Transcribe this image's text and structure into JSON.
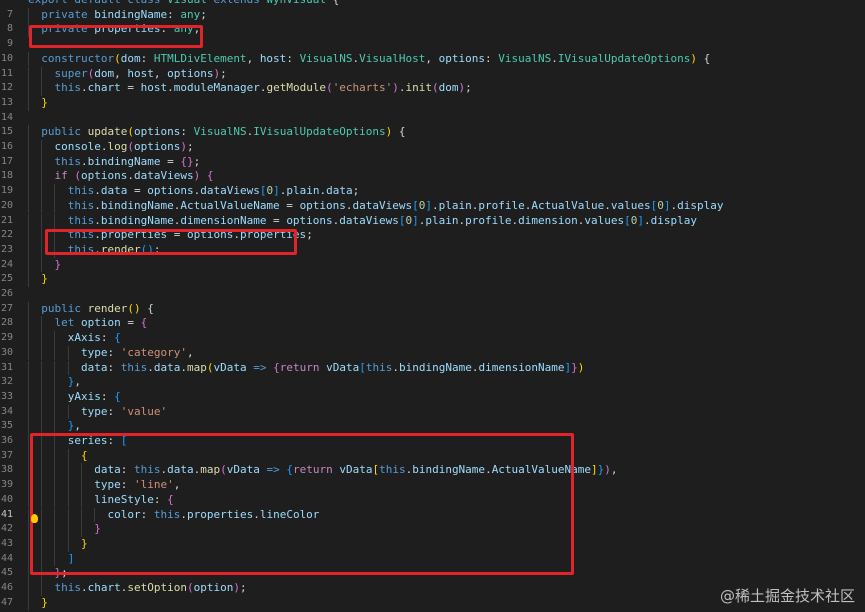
{
  "editor": {
    "lines": [
      {
        "n": "",
        "segs": [
          [
            "k",
            "export "
          ],
          [
            "k",
            "default "
          ],
          [
            "k",
            "class "
          ],
          [
            "t",
            "Visual "
          ],
          [
            "k",
            "extends "
          ],
          [
            "t",
            "WynVisual "
          ],
          [
            "p",
            "{"
          ]
        ]
      },
      {
        "n": "7",
        "segs": [
          [
            "k",
            "  private "
          ],
          [
            "v",
            "bindingName"
          ],
          [
            "p",
            ": "
          ],
          [
            "t",
            "any"
          ],
          [
            "p",
            ";"
          ]
        ]
      },
      {
        "n": "8",
        "segs": [
          [
            "k",
            "  private "
          ],
          [
            "v",
            "properties"
          ],
          [
            "p",
            ": "
          ],
          [
            "t",
            "any"
          ],
          [
            "p",
            ";"
          ]
        ]
      },
      {
        "n": "9",
        "segs": []
      },
      {
        "n": "10",
        "segs": [
          [
            "k",
            "  constructor"
          ],
          [
            "y",
            "("
          ],
          [
            "v",
            "dom"
          ],
          [
            "p",
            ": "
          ],
          [
            "t",
            "HTMLDivElement"
          ],
          [
            "p",
            ", "
          ],
          [
            "v",
            "host"
          ],
          [
            "p",
            ": "
          ],
          [
            "t",
            "VisualNS"
          ],
          [
            "p",
            "."
          ],
          [
            "t",
            "VisualHost"
          ],
          [
            "p",
            ", "
          ],
          [
            "v",
            "options"
          ],
          [
            "p",
            ": "
          ],
          [
            "t",
            "VisualNS"
          ],
          [
            "p",
            "."
          ],
          [
            "t",
            "IVisualUpdateOptions"
          ],
          [
            "y",
            ")"
          ],
          [
            "p",
            " {"
          ]
        ]
      },
      {
        "n": "11",
        "segs": [
          [
            "k",
            "    super"
          ],
          [
            "pk",
            "("
          ],
          [
            "v",
            "dom"
          ],
          [
            "p",
            ", "
          ],
          [
            "v",
            "host"
          ],
          [
            "p",
            ", "
          ],
          [
            "v",
            "options"
          ],
          [
            "pk",
            ")"
          ],
          [
            "p",
            ";"
          ]
        ]
      },
      {
        "n": "12",
        "segs": [
          [
            "k",
            "    this"
          ],
          [
            "p",
            "."
          ],
          [
            "v",
            "chart"
          ],
          [
            "p",
            " = "
          ],
          [
            "v",
            "host"
          ],
          [
            "p",
            "."
          ],
          [
            "v",
            "moduleManager"
          ],
          [
            "p",
            "."
          ],
          [
            "f",
            "getModule"
          ],
          [
            "pk",
            "("
          ],
          [
            "s",
            "'echarts'"
          ],
          [
            "pk",
            ")"
          ],
          [
            "p",
            "."
          ],
          [
            "f",
            "init"
          ],
          [
            "pk",
            "("
          ],
          [
            "v",
            "dom"
          ],
          [
            "pk",
            ")"
          ],
          [
            "p",
            ";"
          ]
        ]
      },
      {
        "n": "13",
        "segs": [
          [
            "y",
            "  }"
          ]
        ]
      },
      {
        "n": "14",
        "segs": []
      },
      {
        "n": "15",
        "segs": [
          [
            "k",
            "  public "
          ],
          [
            "f",
            "update"
          ],
          [
            "y",
            "("
          ],
          [
            "v",
            "options"
          ],
          [
            "p",
            ": "
          ],
          [
            "t",
            "VisualNS"
          ],
          [
            "p",
            "."
          ],
          [
            "t",
            "IVisualUpdateOptions"
          ],
          [
            "y",
            ")"
          ],
          [
            "p",
            " {"
          ]
        ]
      },
      {
        "n": "16",
        "segs": [
          [
            "v",
            "    console"
          ],
          [
            "p",
            "."
          ],
          [
            "f",
            "log"
          ],
          [
            "pk",
            "("
          ],
          [
            "v",
            "options"
          ],
          [
            "pk",
            ")"
          ],
          [
            "p",
            ";"
          ]
        ]
      },
      {
        "n": "17",
        "segs": [
          [
            "k",
            "    this"
          ],
          [
            "p",
            "."
          ],
          [
            "v",
            "bindingName"
          ],
          [
            "p",
            " = "
          ],
          [
            "pk",
            "{}"
          ],
          [
            "p",
            ";"
          ]
        ]
      },
      {
        "n": "18",
        "segs": [
          [
            "c",
            "    if "
          ],
          [
            "pk",
            "("
          ],
          [
            "v",
            "options"
          ],
          [
            "p",
            "."
          ],
          [
            "v",
            "dataViews"
          ],
          [
            "pk",
            ")"
          ],
          [
            "p",
            " "
          ],
          [
            "pk",
            "{"
          ]
        ]
      },
      {
        "n": "19",
        "segs": [
          [
            "k",
            "      this"
          ],
          [
            "p",
            "."
          ],
          [
            "v",
            "data"
          ],
          [
            "p",
            " = "
          ],
          [
            "v",
            "options"
          ],
          [
            "p",
            "."
          ],
          [
            "v",
            "dataViews"
          ],
          [
            "bl",
            "["
          ],
          [
            "n",
            "0"
          ],
          [
            "bl",
            "]"
          ],
          [
            "p",
            "."
          ],
          [
            "v",
            "plain"
          ],
          [
            "p",
            "."
          ],
          [
            "v",
            "data"
          ],
          [
            "p",
            ";"
          ]
        ]
      },
      {
        "n": "20",
        "segs": [
          [
            "k",
            "      this"
          ],
          [
            "p",
            "."
          ],
          [
            "v",
            "bindingName"
          ],
          [
            "p",
            "."
          ],
          [
            "v",
            "ActualValueName"
          ],
          [
            "p",
            " = "
          ],
          [
            "v",
            "options"
          ],
          [
            "p",
            "."
          ],
          [
            "v",
            "dataViews"
          ],
          [
            "bl",
            "["
          ],
          [
            "n",
            "0"
          ],
          [
            "bl",
            "]"
          ],
          [
            "p",
            "."
          ],
          [
            "v",
            "plain"
          ],
          [
            "p",
            "."
          ],
          [
            "v",
            "profile"
          ],
          [
            "p",
            "."
          ],
          [
            "v",
            "ActualValue"
          ],
          [
            "p",
            "."
          ],
          [
            "v",
            "values"
          ],
          [
            "bl",
            "["
          ],
          [
            "n",
            "0"
          ],
          [
            "bl",
            "]"
          ],
          [
            "p",
            "."
          ],
          [
            "v",
            "display"
          ]
        ]
      },
      {
        "n": "21",
        "segs": [
          [
            "k",
            "      this"
          ],
          [
            "p",
            "."
          ],
          [
            "v",
            "bindingName"
          ],
          [
            "p",
            "."
          ],
          [
            "v",
            "dimensionName"
          ],
          [
            "p",
            " = "
          ],
          [
            "v",
            "options"
          ],
          [
            "p",
            "."
          ],
          [
            "v",
            "dataViews"
          ],
          [
            "bl",
            "["
          ],
          [
            "n",
            "0"
          ],
          [
            "bl",
            "]"
          ],
          [
            "p",
            "."
          ],
          [
            "v",
            "plain"
          ],
          [
            "p",
            "."
          ],
          [
            "v",
            "profile"
          ],
          [
            "p",
            "."
          ],
          [
            "v",
            "dimension"
          ],
          [
            "p",
            "."
          ],
          [
            "v",
            "values"
          ],
          [
            "bl",
            "["
          ],
          [
            "n",
            "0"
          ],
          [
            "bl",
            "]"
          ],
          [
            "p",
            "."
          ],
          [
            "v",
            "display"
          ]
        ]
      },
      {
        "n": "22",
        "segs": [
          [
            "k",
            "      this"
          ],
          [
            "p",
            "."
          ],
          [
            "v",
            "properties"
          ],
          [
            "p",
            " = "
          ],
          [
            "v",
            "options"
          ],
          [
            "p",
            "."
          ],
          [
            "v",
            "properties"
          ],
          [
            "p",
            ";"
          ]
        ]
      },
      {
        "n": "23",
        "segs": [
          [
            "k",
            "      this"
          ],
          [
            "p",
            "."
          ],
          [
            "f",
            "render"
          ],
          [
            "bl",
            "()"
          ],
          [
            "p",
            ";"
          ]
        ]
      },
      {
        "n": "24",
        "segs": [
          [
            "pk",
            "    }"
          ]
        ]
      },
      {
        "n": "25",
        "segs": [
          [
            "y",
            "  }"
          ]
        ]
      },
      {
        "n": "26",
        "segs": []
      },
      {
        "n": "27",
        "segs": [
          [
            "k",
            "  public "
          ],
          [
            "f",
            "render"
          ],
          [
            "y",
            "()"
          ],
          [
            "p",
            " {"
          ]
        ]
      },
      {
        "n": "28",
        "segs": [
          [
            "k",
            "    let "
          ],
          [
            "v",
            "option"
          ],
          [
            "p",
            " = "
          ],
          [
            "pk",
            "{"
          ]
        ]
      },
      {
        "n": "29",
        "segs": [
          [
            "v",
            "      xAxis"
          ],
          [
            "p",
            ": "
          ],
          [
            "bl",
            "{"
          ]
        ]
      },
      {
        "n": "30",
        "segs": [
          [
            "v",
            "        type"
          ],
          [
            "p",
            ": "
          ],
          [
            "s",
            "'category'"
          ],
          [
            "p",
            ","
          ]
        ]
      },
      {
        "n": "31",
        "segs": [
          [
            "v",
            "        data"
          ],
          [
            "p",
            ": "
          ],
          [
            "k",
            "this"
          ],
          [
            "p",
            "."
          ],
          [
            "v",
            "data"
          ],
          [
            "p",
            "."
          ],
          [
            "f",
            "map"
          ],
          [
            "y",
            "("
          ],
          [
            "v",
            "vData"
          ],
          [
            "k",
            " => "
          ],
          [
            "pk",
            "{"
          ],
          [
            "c",
            "return "
          ],
          [
            "v",
            "vData"
          ],
          [
            "bl",
            "["
          ],
          [
            "k",
            "this"
          ],
          [
            "p",
            "."
          ],
          [
            "v",
            "bindingName"
          ],
          [
            "p",
            "."
          ],
          [
            "v",
            "dimensionName"
          ],
          [
            "bl",
            "]"
          ],
          [
            "pk",
            "}"
          ],
          [
            "y",
            ")"
          ]
        ]
      },
      {
        "n": "32",
        "segs": [
          [
            "bl",
            "      }"
          ],
          [
            "p",
            ","
          ]
        ]
      },
      {
        "n": "33",
        "segs": [
          [
            "v",
            "      yAxis"
          ],
          [
            "p",
            ": "
          ],
          [
            "bl",
            "{"
          ]
        ]
      },
      {
        "n": "34",
        "segs": [
          [
            "v",
            "        type"
          ],
          [
            "p",
            ": "
          ],
          [
            "s",
            "'value'"
          ]
        ]
      },
      {
        "n": "35",
        "segs": [
          [
            "bl",
            "      }"
          ],
          [
            "p",
            ","
          ]
        ]
      },
      {
        "n": "36",
        "segs": [
          [
            "v",
            "      series"
          ],
          [
            "p",
            ": "
          ],
          [
            "bl",
            "["
          ]
        ]
      },
      {
        "n": "37",
        "segs": [
          [
            "y",
            "        {"
          ]
        ]
      },
      {
        "n": "38",
        "segs": [
          [
            "v",
            "          data"
          ],
          [
            "p",
            ": "
          ],
          [
            "k",
            "this"
          ],
          [
            "p",
            "."
          ],
          [
            "v",
            "data"
          ],
          [
            "p",
            "."
          ],
          [
            "f",
            "map"
          ],
          [
            "pk",
            "("
          ],
          [
            "v",
            "vData"
          ],
          [
            "k",
            " => "
          ],
          [
            "bl",
            "{"
          ],
          [
            "c",
            "return "
          ],
          [
            "v",
            "vData"
          ],
          [
            "y",
            "["
          ],
          [
            "k",
            "this"
          ],
          [
            "p",
            "."
          ],
          [
            "v",
            "bindingName"
          ],
          [
            "p",
            "."
          ],
          [
            "v",
            "ActualValueName"
          ],
          [
            "y",
            "]"
          ],
          [
            "bl",
            "}"
          ],
          [
            "pk",
            ")"
          ],
          [
            "p",
            ","
          ]
        ]
      },
      {
        "n": "39",
        "segs": [
          [
            "v",
            "          type"
          ],
          [
            "p",
            ": "
          ],
          [
            "s",
            "'line'"
          ],
          [
            "p",
            ","
          ]
        ]
      },
      {
        "n": "40",
        "segs": [
          [
            "v",
            "          lineStyle"
          ],
          [
            "p",
            ": "
          ],
          [
            "pk",
            "{"
          ]
        ]
      },
      {
        "n": "41",
        "segs": [
          [
            "v",
            "            color"
          ],
          [
            "p",
            ": "
          ],
          [
            "k",
            "this"
          ],
          [
            "p",
            "."
          ],
          [
            "v",
            "properties"
          ],
          [
            "p",
            "."
          ],
          [
            "v",
            "lineColor"
          ]
        ]
      },
      {
        "n": "42",
        "segs": [
          [
            "pk",
            "          }"
          ]
        ]
      },
      {
        "n": "43",
        "segs": [
          [
            "y",
            "        }"
          ]
        ]
      },
      {
        "n": "44",
        "segs": [
          [
            "bl",
            "      ]"
          ]
        ]
      },
      {
        "n": "45",
        "segs": [
          [
            "pk",
            "    }"
          ],
          [
            "p",
            ";"
          ]
        ]
      },
      {
        "n": "46",
        "segs": [
          [
            "k",
            "    this"
          ],
          [
            "p",
            "."
          ],
          [
            "v",
            "chart"
          ],
          [
            "p",
            "."
          ],
          [
            "f",
            "setOption"
          ],
          [
            "pk",
            "("
          ],
          [
            "v",
            "option"
          ],
          [
            "pk",
            ")"
          ],
          [
            "p",
            ";"
          ]
        ]
      },
      {
        "n": "47",
        "segs": [
          [
            "y",
            "  }"
          ]
        ]
      }
    ]
  },
  "watermark": "@稀土掘金技术社区"
}
